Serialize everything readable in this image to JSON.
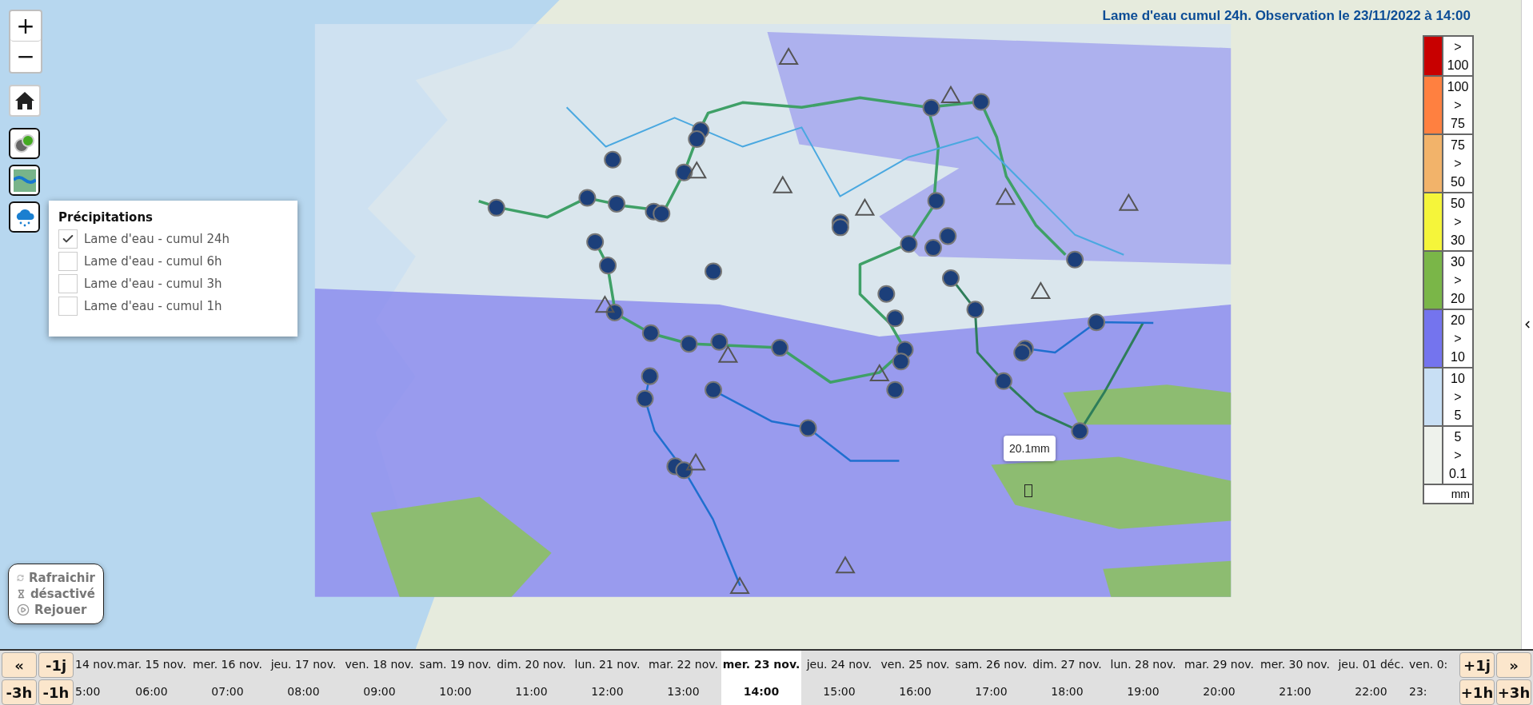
{
  "title": "Lame d'eau cumul 24h. Observation le 23/11/2022 à 14:00",
  "zoom": {
    "zoom_in": "+",
    "zoom_out": "−"
  },
  "layer_buttons": [
    {
      "kind": "stations"
    },
    {
      "kind": "rivers"
    },
    {
      "kind": "rain"
    }
  ],
  "layer_popup": {
    "title": "Précipitations",
    "options": [
      {
        "label": "Lame d'eau - cumul 24h",
        "checked": true
      },
      {
        "label": "Lame d'eau - cumul 6h",
        "checked": false
      },
      {
        "label": "Lame d'eau - cumul 3h",
        "checked": false
      },
      {
        "label": "Lame d'eau - cumul 1h",
        "checked": false
      }
    ]
  },
  "tooltip": "20.1mm",
  "legend": {
    "entries": [
      {
        "color": "#c80000",
        "label": "> 100"
      },
      {
        "color": "#ff8040",
        "label": "100 > 75"
      },
      {
        "color": "#f2b36a",
        "label": "75 > 50"
      },
      {
        "color": "#f5f53a",
        "label": "50 > 30"
      },
      {
        "color": "#7ab648",
        "label": "30 > 20"
      },
      {
        "color": "#7474ee",
        "label": "20 > 10"
      },
      {
        "color": "#c8dff4",
        "label": "10 > 5"
      },
      {
        "color": "#eef2ec",
        "label": "5 > 0.1"
      }
    ],
    "unit": "mm"
  },
  "playback": [
    {
      "kind": "refresh",
      "label": "Rafraichir"
    },
    {
      "kind": "hourglass",
      "label": "désactivé"
    },
    {
      "kind": "play",
      "label": "Rejouer"
    }
  ],
  "timeline": {
    "left_buttons": [
      "«",
      "-1j",
      "-3h",
      "-1h"
    ],
    "right_buttons": [
      "+1j",
      "»",
      "+1h",
      "+3h"
    ],
    "columns": [
      {
        "date": "14 nov.",
        "time": "5:00",
        "selected": false
      },
      {
        "date": "mar. 15 nov.",
        "time": "06:00",
        "selected": false
      },
      {
        "date": "mer. 16 nov.",
        "time": "07:00",
        "selected": false
      },
      {
        "date": "jeu. 17 nov.",
        "time": "08:00",
        "selected": false
      },
      {
        "date": "ven. 18 nov.",
        "time": "09:00",
        "selected": false
      },
      {
        "date": "sam. 19 nov.",
        "time": "10:00",
        "selected": false
      },
      {
        "date": "dim. 20 nov.",
        "time": "11:00",
        "selected": false
      },
      {
        "date": "lun. 21 nov.",
        "time": "12:00",
        "selected": false
      },
      {
        "date": "mar. 22 nov.",
        "time": "13:00",
        "selected": false
      },
      {
        "date": "mer. 23 nov.",
        "time": "14:00",
        "selected": true
      },
      {
        "date": "jeu. 24 nov.",
        "time": "15:00",
        "selected": false
      },
      {
        "date": "ven. 25 nov.",
        "time": "16:00",
        "selected": false
      },
      {
        "date": "sam. 26 nov.",
        "time": "17:00",
        "selected": false
      },
      {
        "date": "dim. 27 nov.",
        "time": "18:00",
        "selected": false
      },
      {
        "date": "lun. 28 nov.",
        "time": "19:00",
        "selected": false
      },
      {
        "date": "mar. 29 nov.",
        "time": "20:00",
        "selected": false
      },
      {
        "date": "mer. 30 nov.",
        "time": "21:00",
        "selected": false
      },
      {
        "date": "jeu. 01 déc.",
        "time": "22:00",
        "selected": false
      },
      {
        "date": "ven. 0:",
        "time": "23:",
        "selected": false
      }
    ]
  }
}
